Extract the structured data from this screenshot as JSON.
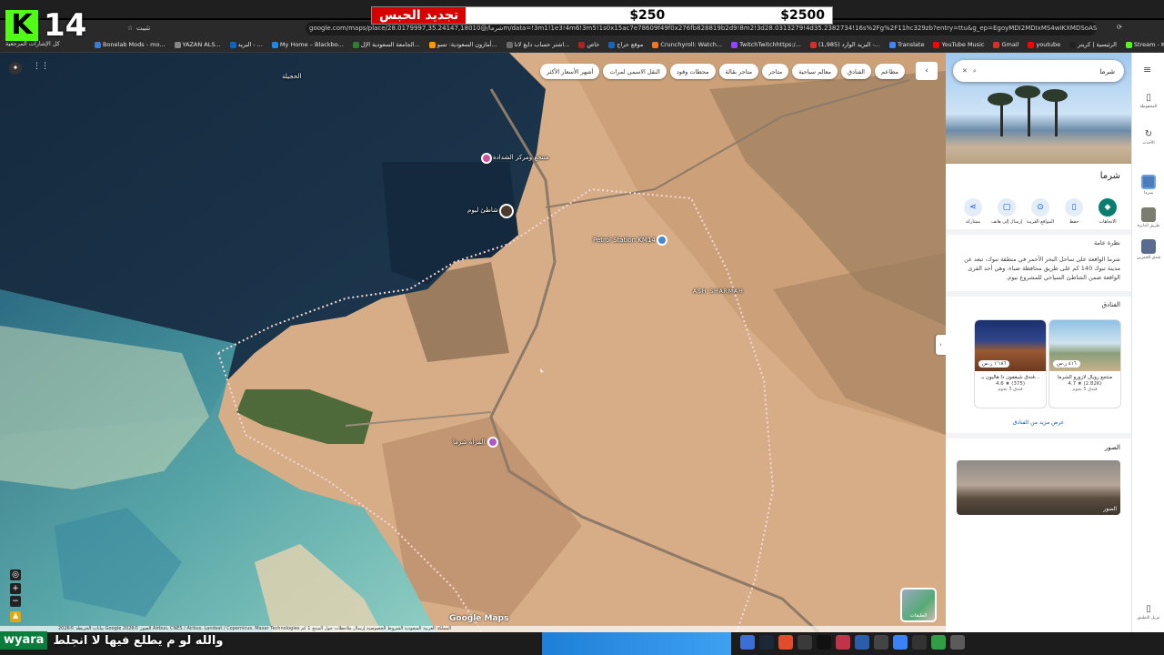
{
  "stream": {
    "brand_letter": "K",
    "counter": "14",
    "banner_red": "تجديد الحبس",
    "banner_price1": "$250",
    "banner_price2": "$2500",
    "caption_name": "wyara",
    "caption_text": "والله لو م يطلع فيها لا انجلط"
  },
  "browser": {
    "address": "google.com/maps/place/شرما/@28.0179997,35.24147,18010m/data=!3m1!1e3!4m6!3m5!1s0x15ac7e78609f49f0x276fb828819b2d9!8m2!3d28.0313279!4d35.2382734!16s%2Fg%2F11hc329zb?entry=ttu&g_ep=EgoyMDI2MDIxMS4wIKXMDSoASAFQAw%3D%3D",
    "install_label": "تثبيت",
    "bookmarks": [
      {
        "label": "Bonelab Mods - mo...",
        "color": "#3a7bd5"
      },
      {
        "label": "YAZAN ALS...",
        "color": "#888888"
      },
      {
        "label": "البريد - ...",
        "color": "#0a66c2"
      },
      {
        "label": "My Home – Blackbo...",
        "color": "#1e88e5"
      },
      {
        "label": "الجامعة السعودية الإل...",
        "color": "#2e7d32"
      },
      {
        "label": "أمازون السعودية: تسو...",
        "color": "#ff9900"
      },
      {
        "label": "اشتر حساب دايغ لانا...",
        "color": "#6b6b6b"
      },
      {
        "label": "خاص",
        "color": "#aa2222"
      },
      {
        "label": "موقع حراج",
        "color": "#1565c0"
      },
      {
        "label": "Crunchyroll: Watch...",
        "color": "#f47521"
      },
      {
        "label": "TwitchTwitchhttps:/...",
        "color": "#9146ff"
      },
      {
        "label": "(1,985) البريد الوارد -...",
        "color": "#d93025"
      },
      {
        "label": "Translate",
        "color": "#4285f4"
      },
      {
        "label": "YouTube Music",
        "color": "#ff0000"
      },
      {
        "label": "Gmail",
        "color": "#d93025"
      },
      {
        "label": "youtube",
        "color": "#ff0000"
      },
      {
        "label": "الرئيسية | كريتر",
        "color": "#222222"
      },
      {
        "label": "Stream - Kick Dashb...",
        "color": "#53fc18"
      },
      {
        "label": "Kick",
        "color": "#53fc18"
      },
      {
        "label": "Google",
        "color": "#4285f4"
      }
    ],
    "bookmarks_all": "كل الإشارات المرجعية"
  },
  "map": {
    "labels": [
      {
        "text": "الحجيلة",
        "pos": "top-left"
      },
      {
        "text": "منتجع ومركز الشدادة",
        "pos": "upper"
      },
      {
        "text": "شاطئ ليوم",
        "pos": "bay"
      },
      {
        "text": "Petrol Station KM14",
        "pos": "center"
      },
      {
        "text": "ASH SHARMAH",
        "pos": "right"
      },
      {
        "text": "المراه شرما",
        "pos": "south"
      }
    ],
    "filter_chips": [
      "مطاعم",
      "الفنادق",
      "معالم سياحية",
      "متاجر",
      "متاجر بقالة",
      "محطات وقود",
      "النقل الاسمي لمرات",
      "أشهر الأسعار الأكثر"
    ],
    "google_logo": "Google Maps",
    "layers_label": "الطبقات",
    "attribution": "بيانات الخريطة ©2026 Google  الصور ©2026 Airbus، CNES / Airbus، Landsat / Copernicus، Maxar Technologies  المملكة العربية السعودية  الشروط  الخصوصية  إرسال ملاحظات حول المنتج  1 كم"
  },
  "panel": {
    "search_query": "شرما",
    "place_title": "شرما",
    "actions": [
      {
        "label": "الاتجاهات",
        "icon": "directions-icon",
        "primary": true
      },
      {
        "label": "حفظ",
        "icon": "bookmark-icon",
        "primary": false
      },
      {
        "label": "المواقع القريبة",
        "icon": "nearby-icon",
        "primary": false
      },
      {
        "label": "إرسال إلى هاتف",
        "icon": "phone-icon",
        "primary": false
      },
      {
        "label": "مشاركة",
        "icon": "share-icon",
        "primary": false
      }
    ],
    "overview_heading": "نظرة عامة",
    "overview_text": "شرما الواقعة على ساحل البحر الأحمر في منطقة تبوك، تبعد عن مدينة تبوك 140 كم على طريق محافظة ضباء، وهي أحد القرى الواقعة ضمن الشاطئ السياحي للمشروع نيوم.",
    "hotels_heading": "الفنادق",
    "hotels": [
      {
        "name": "منتجع رويال لازورو الشرما",
        "price": "٤١٦ ر.س",
        "rating": "4.7",
        "reviews": "(2.82K)",
        "class": "فندق 5 نجوم"
      },
      {
        "name": "فندق شيغفون ذا هاليون بـ...",
        "price": "١٬١٨٦ ر.س",
        "rating": "4.6",
        "reviews": "(375)",
        "class": "فندق 3 نجوم"
      }
    ],
    "more_hotels": "عرض مزيد من الفنادق",
    "photos_heading": "الصور",
    "photo_label": "الصور"
  },
  "rail": {
    "items": [
      {
        "label": "المحفوظة",
        "icon": "bookmark-icon"
      },
      {
        "label": "الأحدث",
        "icon": "history-icon"
      },
      {
        "label": "شرما",
        "icon": "place-thumb"
      },
      {
        "label": "طريق الدايرة",
        "icon": "place-thumb"
      },
      {
        "label": "فندق الحمرين",
        "icon": "place-thumb"
      },
      {
        "label": "تنزيل التطبيق",
        "icon": "phone-icon"
      }
    ]
  },
  "colors": {
    "accent": "#0a7d6f",
    "link": "#0b57d0",
    "kick_green": "#53fc18",
    "banner_red": "#d60000"
  }
}
